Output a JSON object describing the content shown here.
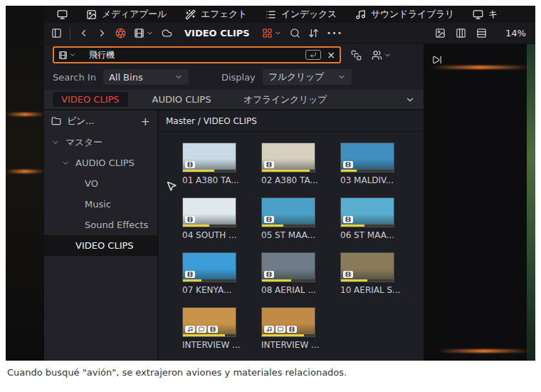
{
  "topbar": {
    "items": [
      "メディアプール",
      "エフェクト",
      "インデックス",
      "サウンドライブラリ",
      "キ"
    ]
  },
  "toolbar": {
    "title": "VIDEO CLIPS",
    "more": "•••"
  },
  "viewer": {
    "zoom": "14%"
  },
  "search": {
    "value": "飛行機",
    "focused": true,
    "clear": "×"
  },
  "search_in": {
    "label": "Search In",
    "value": "All Bins"
  },
  "display": {
    "label": "Display",
    "value": "フルクリップ"
  },
  "tabs": [
    {
      "label": "VIDEO CLIPS",
      "selected": true
    },
    {
      "label": "AUDIO CLIPS",
      "selected": false
    },
    {
      "label": "オフラインクリップ",
      "selected": false
    }
  ],
  "sidebar": {
    "title": "ビン...",
    "add": "+",
    "items": [
      {
        "label": "マスター",
        "depth": 0,
        "expanded": true,
        "selected": false
      },
      {
        "label": "AUDIO CLIPS",
        "depth": 1,
        "expanded": true,
        "selected": false
      },
      {
        "label": "VO",
        "depth": 2,
        "expanded": false,
        "selected": false
      },
      {
        "label": "Music",
        "depth": 2,
        "expanded": false,
        "selected": false
      },
      {
        "label": "Sound Effects",
        "depth": 2,
        "expanded": false,
        "selected": false
      },
      {
        "label": "VIDEO CLIPS",
        "depth": 1,
        "expanded": false,
        "selected": true
      }
    ]
  },
  "breadcrumb": "Master / VIDEO CLIPS",
  "clips": [
    {
      "name": "01 A380 TA...",
      "kind": "video",
      "color": "#c9d9e6",
      "level": 0.6
    },
    {
      "name": "02 A380 TA...",
      "kind": "video",
      "color": "#d6d0c0",
      "level": 0.9
    },
    {
      "name": "03 MALDIV...",
      "kind": "video",
      "color": "#3f8fbf",
      "level": 0.3
    },
    {
      "name": "04 SOUTH ...",
      "kind": "video",
      "color": "#dfe8ea",
      "level": 0.5
    },
    {
      "name": "05 ST MAA...",
      "kind": "video",
      "color": "#4aa0c8",
      "level": 0.4
    },
    {
      "name": "06 ST MAA...",
      "kind": "video",
      "color": "#58aed0",
      "level": 0.45
    },
    {
      "name": "07 KENYA...",
      "kind": "video",
      "color": "#3b9ed8",
      "level": 0.35
    },
    {
      "name": "08 AERIAL ...",
      "kind": "video",
      "color": "#6f7b88",
      "level": 0.55
    },
    {
      "name": "10 AERIAL S...",
      "kind": "video",
      "color": "#8a7a5a",
      "level": 0.5
    },
    {
      "name": "INTERVIEW ...",
      "kind": "av",
      "color": "#c8944a",
      "level": 0.8
    },
    {
      "name": "INTERVIEW ...",
      "kind": "av",
      "color": "#c08a46",
      "level": 0.8
    }
  ],
  "caption": "Cuando busqué \"avión\", se extrajeron aviones y materiales relacionados."
}
